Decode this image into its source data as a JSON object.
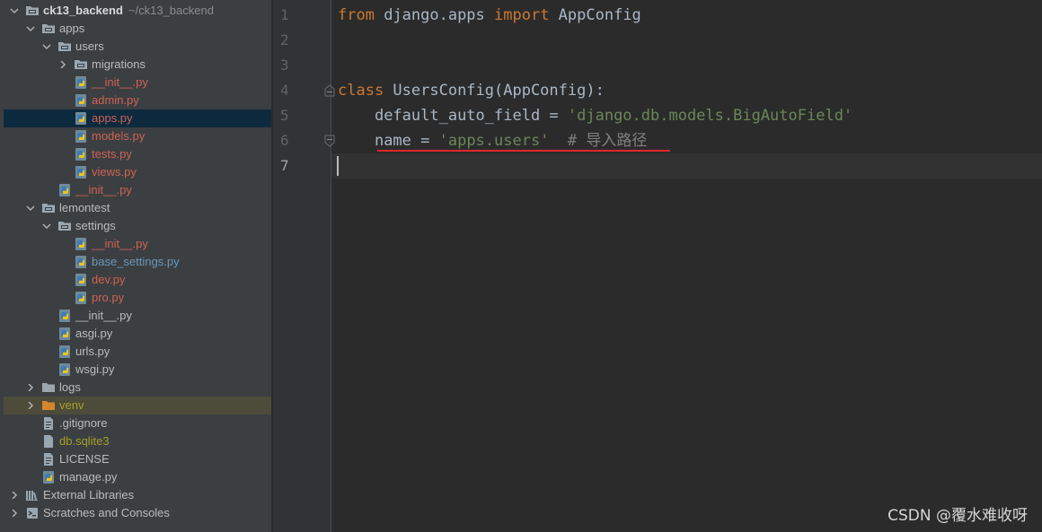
{
  "project_tree": {
    "root_name": "ck13_backend",
    "root_path": "~/ck13_backend",
    "items": [
      {
        "label": "apps"
      },
      {
        "label": "users"
      },
      {
        "label": "migrations"
      },
      {
        "label": "__init__.py"
      },
      {
        "label": "admin.py"
      },
      {
        "label": "apps.py"
      },
      {
        "label": "models.py"
      },
      {
        "label": "tests.py"
      },
      {
        "label": "views.py"
      },
      {
        "label": "__init__.py"
      },
      {
        "label": "lemontest"
      },
      {
        "label": "settings"
      },
      {
        "label": "__init__.py"
      },
      {
        "label": "base_settings.py"
      },
      {
        "label": "dev.py"
      },
      {
        "label": "pro.py"
      },
      {
        "label": "__init__.py"
      },
      {
        "label": "asgi.py"
      },
      {
        "label": "urls.py"
      },
      {
        "label": "wsgi.py"
      },
      {
        "label": "logs"
      },
      {
        "label": "venv"
      },
      {
        "label": ".gitignore"
      },
      {
        "label": "db.sqlite3"
      },
      {
        "label": "LICENSE"
      },
      {
        "label": "manage.py"
      },
      {
        "label": "External Libraries"
      },
      {
        "label": "Scratches and Consoles"
      }
    ]
  },
  "editor": {
    "line_numbers": [
      "1",
      "2",
      "3",
      "4",
      "5",
      "6",
      "7"
    ],
    "line1": {
      "kw_from": "from",
      "module": " django.apps ",
      "kw_import": "import",
      "name": " AppConfig"
    },
    "line4": {
      "kw_class": "class",
      "rest": " UsersConfig(AppConfig):"
    },
    "line5": {
      "indent": "    ",
      "attr": "default_auto_field = ",
      "value": "'django.db.models.BigAutoField'"
    },
    "line6": {
      "indent": "    ",
      "attr": "name = ",
      "value": "'apps.users'",
      "comment": "  # 导入路径"
    }
  },
  "watermark": "CSDN @覆水难收呀",
  "colors": {
    "keyword": "#cc7832",
    "string": "#6a8759",
    "comment": "#808080",
    "highlight_underline": "#e0262f",
    "selected_row": "#0d293e"
  }
}
